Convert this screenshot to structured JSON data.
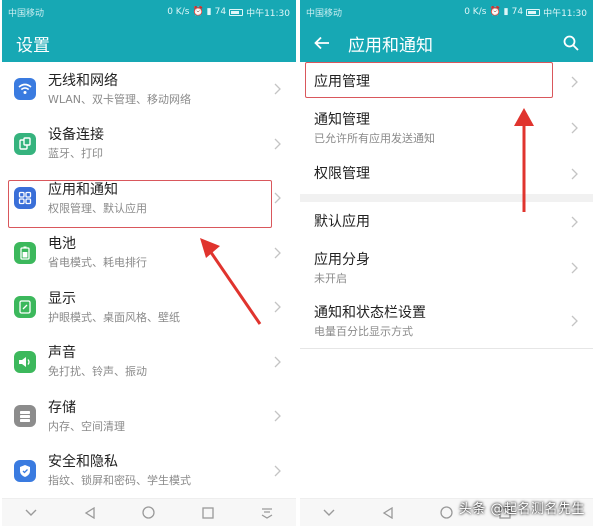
{
  "statusbar": {
    "carrier": "中国移动",
    "speed": "0 K/s",
    "battery": "74",
    "time": "中午11:30"
  },
  "left": {
    "title": "设置",
    "items": [
      {
        "title": "无线和网络",
        "sub": "WLAN、双卡管理、移动网络",
        "icon": "wifi-icon",
        "color": "#3a7be0"
      },
      {
        "title": "设备连接",
        "sub": "蓝牙、打印",
        "icon": "device-connect-icon",
        "color": "#36b37e"
      },
      {
        "title": "应用和通知",
        "sub": "权限管理、默认应用",
        "icon": "apps-icon",
        "color": "#3a6fd8"
      },
      {
        "title": "电池",
        "sub": "省电模式、耗电排行",
        "icon": "battery-icon",
        "color": "#3cb85c"
      },
      {
        "title": "显示",
        "sub": "护眼模式、桌面风格、壁纸",
        "icon": "display-icon",
        "color": "#3cb85c"
      },
      {
        "title": "声音",
        "sub": "免打扰、铃声、振动",
        "icon": "sound-icon",
        "color": "#3cb85c"
      },
      {
        "title": "存储",
        "sub": "内存、空间清理",
        "icon": "storage-icon",
        "color": "#8c8c8c"
      },
      {
        "title": "安全和隐私",
        "sub": "指纹、锁屏和密码、学生模式",
        "icon": "shield-icon",
        "color": "#3a7be0"
      }
    ]
  },
  "right": {
    "title": "应用和通知",
    "items": [
      {
        "title": "应用管理",
        "sub": ""
      },
      {
        "title": "通知管理",
        "sub": "已允许所有应用发送通知"
      },
      {
        "title": "权限管理",
        "sub": ""
      },
      {
        "title": "默认应用",
        "sub": ""
      },
      {
        "title": "应用分身",
        "sub": "未开启"
      },
      {
        "title": "通知和状态栏设置",
        "sub": "电量百分比显示方式"
      }
    ]
  },
  "watermark": "头条 @起名测名先生",
  "colors": {
    "accent": "#17a8b4",
    "highlight": "#d9575c",
    "arrow": "#e0342e"
  }
}
